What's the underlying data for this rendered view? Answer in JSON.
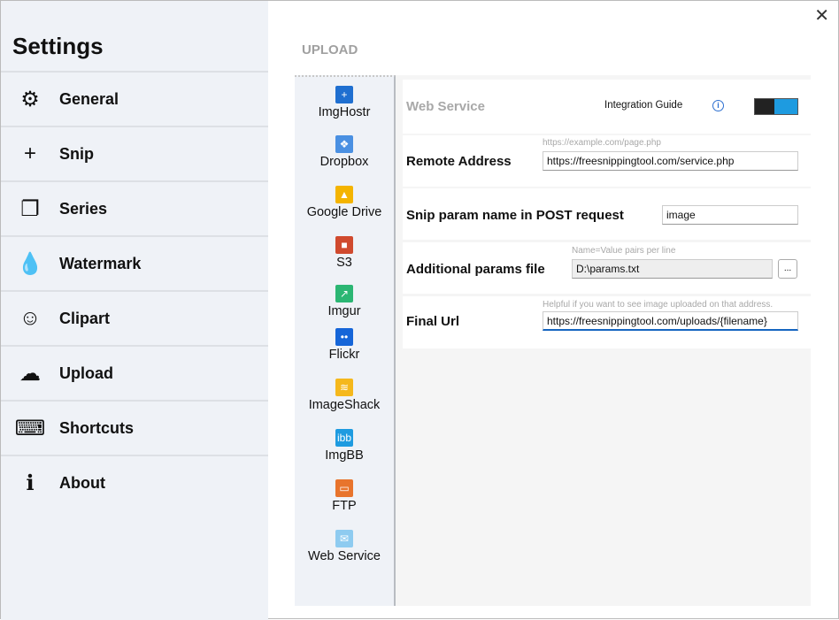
{
  "sidebar": {
    "title": "Settings",
    "items": [
      {
        "label": "General",
        "icon": "gear-icon"
      },
      {
        "label": "Snip",
        "icon": "plus-icon"
      },
      {
        "label": "Series",
        "icon": "series-icon"
      },
      {
        "label": "Watermark",
        "icon": "drops-icon"
      },
      {
        "label": "Clipart",
        "icon": "smiley-icon"
      },
      {
        "label": "Upload",
        "icon": "cloud-upload-icon"
      },
      {
        "label": "Shortcuts",
        "icon": "keyboard-icon"
      },
      {
        "label": "About",
        "icon": "info-bubble-icon"
      }
    ]
  },
  "section_title": "UPLOAD",
  "providers": [
    {
      "label": "ImgHostr",
      "color": "#1f6fd0",
      "glyph": "+"
    },
    {
      "label": "Dropbox",
      "color": "#4a90e2",
      "glyph": "❖"
    },
    {
      "label": "Google Drive",
      "color": "#f4b400",
      "glyph": "▲"
    },
    {
      "label": "S3",
      "color": "#d04a2e",
      "glyph": "■"
    },
    {
      "label": "Imgur",
      "color": "#2bb673",
      "glyph": "↗"
    },
    {
      "label": "Flickr",
      "color": "#1565d8",
      "glyph": "••"
    },
    {
      "label": "ImageShack",
      "color": "#f5b81c",
      "glyph": "≋"
    },
    {
      "label": "ImgBB",
      "color": "#1e9be0",
      "glyph": "ibb"
    },
    {
      "label": "FTP",
      "color": "#e8742c",
      "glyph": "▭"
    },
    {
      "label": "Web Service",
      "color": "#8ecbf0",
      "glyph": "✉"
    }
  ],
  "form": {
    "title": "Web Service",
    "guide": "Integration Guide",
    "toggle_on": true,
    "remote_label": "Remote Address",
    "remote_hint": "https://example.com/page.php",
    "remote_value": "https://freesnippingtool.com/service.php",
    "param_label": "Snip param name in POST request",
    "param_value": "image",
    "file_label": "Additional params file",
    "file_hint": "Name=Value pairs per line",
    "file_value": "D:\\params.txt",
    "browse": "...",
    "final_label": "Final Url",
    "final_hint": "Helpful if you want to see image uploaded on that address.",
    "final_value": "https://freesnippingtool.com/uploads/{filename}"
  },
  "close": "✕"
}
